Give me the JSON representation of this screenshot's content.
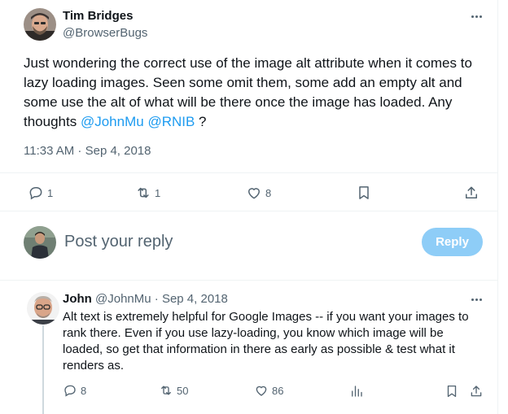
{
  "tweet": {
    "author_name": "Tim Bridges",
    "author_handle": "@BrowserBugs",
    "text_parts": {
      "before": "Just wondering the correct use of the image alt attribute when it comes to lazy loading images. Seen some omit them, some add an empty alt and some use the alt of what will be there once the image has loaded. Any thoughts ",
      "mention1": "@JohnMu",
      "between": " ",
      "mention2": "@RNIB",
      "after": " ?"
    },
    "timestamp": "11:33 AM · Sep 4, 2018",
    "actions": {
      "replies": "1",
      "reposts": "1",
      "likes": "8"
    }
  },
  "composer": {
    "placeholder": "Post your reply",
    "button_label": "Reply"
  },
  "reply": {
    "author_name": "John",
    "author_handle": "@JohnMu",
    "separator": " · ",
    "date": "Sep 4, 2018",
    "text": "Alt text is extremely helpful for Google Images -- if you want your images to rank there. Even if you use lazy-loading, you know which image will be loaded, so get that information in there as early as possible & test what it renders as.",
    "actions": {
      "replies": "8",
      "reposts": "50",
      "likes": "86"
    }
  },
  "colors": {
    "accent": "#1d9bf0",
    "muted": "#536471",
    "reply_button_disabled": "#8ecdf7"
  }
}
